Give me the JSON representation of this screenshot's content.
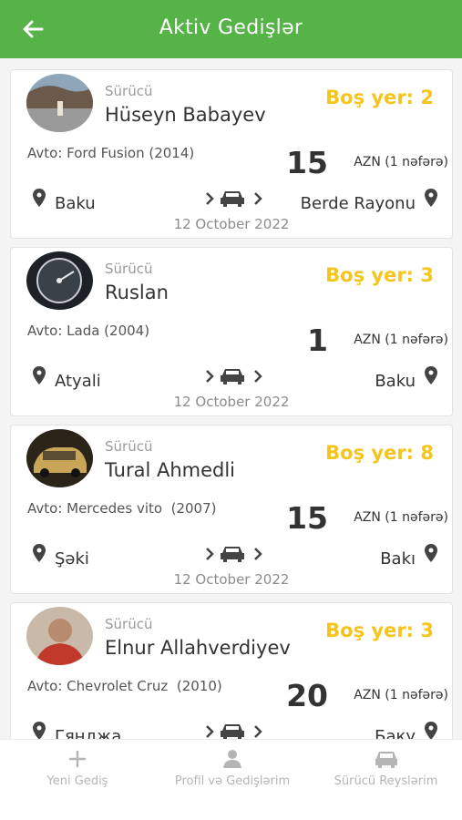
{
  "header": {
    "title": "Aktiv Gedişlər",
    "back_icon": "arrow-left-icon",
    "color": "#56b347"
  },
  "labels": {
    "driver": "Sürücü",
    "currency": "AZN (1 nəfərə)"
  },
  "colors": {
    "seats": "#f5c51c",
    "header": "#56b347"
  },
  "trips": [
    {
      "driver": "Hüseyn Babayev",
      "seats": "Boş yer: 2",
      "car": "Avto: Ford Fusion (2014)",
      "price": "15",
      "from": "Baku",
      "to": "Berde Rayonu",
      "date": "12 October 2022"
    },
    {
      "driver": "Ruslan",
      "seats": "Boş yer: 3",
      "car": "Avto: Lada (2004)",
      "price": "1",
      "from": "Atyali",
      "to": "Baku",
      "date": "12 October 2022"
    },
    {
      "driver": "Tural Ahmedli",
      "seats": "Boş yer: 8",
      "car": "Avto: Mercedes vito  (2007)",
      "price": "15",
      "from": "Şəki",
      "to": "Bakı",
      "date": "12 October 2022"
    },
    {
      "driver": "Elnur Allahverdiyev",
      "seats": "Boş yer: 3",
      "car": "Avto: Chevrolet Cruz  (2010)",
      "price": "20",
      "from": "Гянджа",
      "to": "Баку",
      "date": ""
    }
  ],
  "tabs": [
    {
      "label": "Yeni Gediş",
      "icon": "plus-icon"
    },
    {
      "label": "Profil və Gedişlərim",
      "icon": "user-icon"
    },
    {
      "label": "Sürücü Reyslərim",
      "icon": "car-icon"
    }
  ]
}
